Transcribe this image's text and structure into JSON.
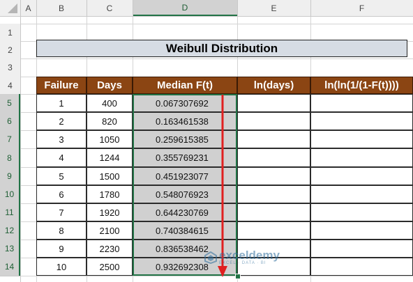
{
  "sheet": {
    "columns": [
      "A",
      "B",
      "C",
      "D",
      "E",
      "F"
    ],
    "rows": [
      "1",
      "2",
      "3",
      "4",
      "5",
      "6",
      "7",
      "8",
      "9",
      "10",
      "11",
      "12",
      "13",
      "14"
    ],
    "selected_column": "D",
    "title": "Weibull Distribution",
    "headers": [
      "Failure",
      "Days",
      "Median F(t)",
      "ln(days)",
      "ln(ln(1/(1-F(t))))"
    ],
    "table": [
      {
        "failure": "1",
        "days": "400",
        "median": "0.067307692"
      },
      {
        "failure": "2",
        "days": "820",
        "median": "0.163461538"
      },
      {
        "failure": "3",
        "days": "1050",
        "median": "0.259615385"
      },
      {
        "failure": "4",
        "days": "1244",
        "median": "0.355769231"
      },
      {
        "failure": "5",
        "days": "1500",
        "median": "0.451923077"
      },
      {
        "failure": "6",
        "days": "1780",
        "median": "0.548076923"
      },
      {
        "failure": "7",
        "days": "1920",
        "median": "0.644230769"
      },
      {
        "failure": "8",
        "days": "2100",
        "median": "0.740384615"
      },
      {
        "failure": "9",
        "days": "2230",
        "median": "0.836538462"
      },
      {
        "failure": "10",
        "days": "2500",
        "median": "0.932692308"
      }
    ]
  },
  "watermark": {
    "brand": "exceldemy",
    "tagline": "EXCEL · DATA · BI"
  },
  "colors": {
    "header_fill": "#8b4513",
    "title_fill": "#d6dce4",
    "selection": "#217346",
    "selected_fill": "#d0d0d0",
    "arrow": "#e02020"
  }
}
